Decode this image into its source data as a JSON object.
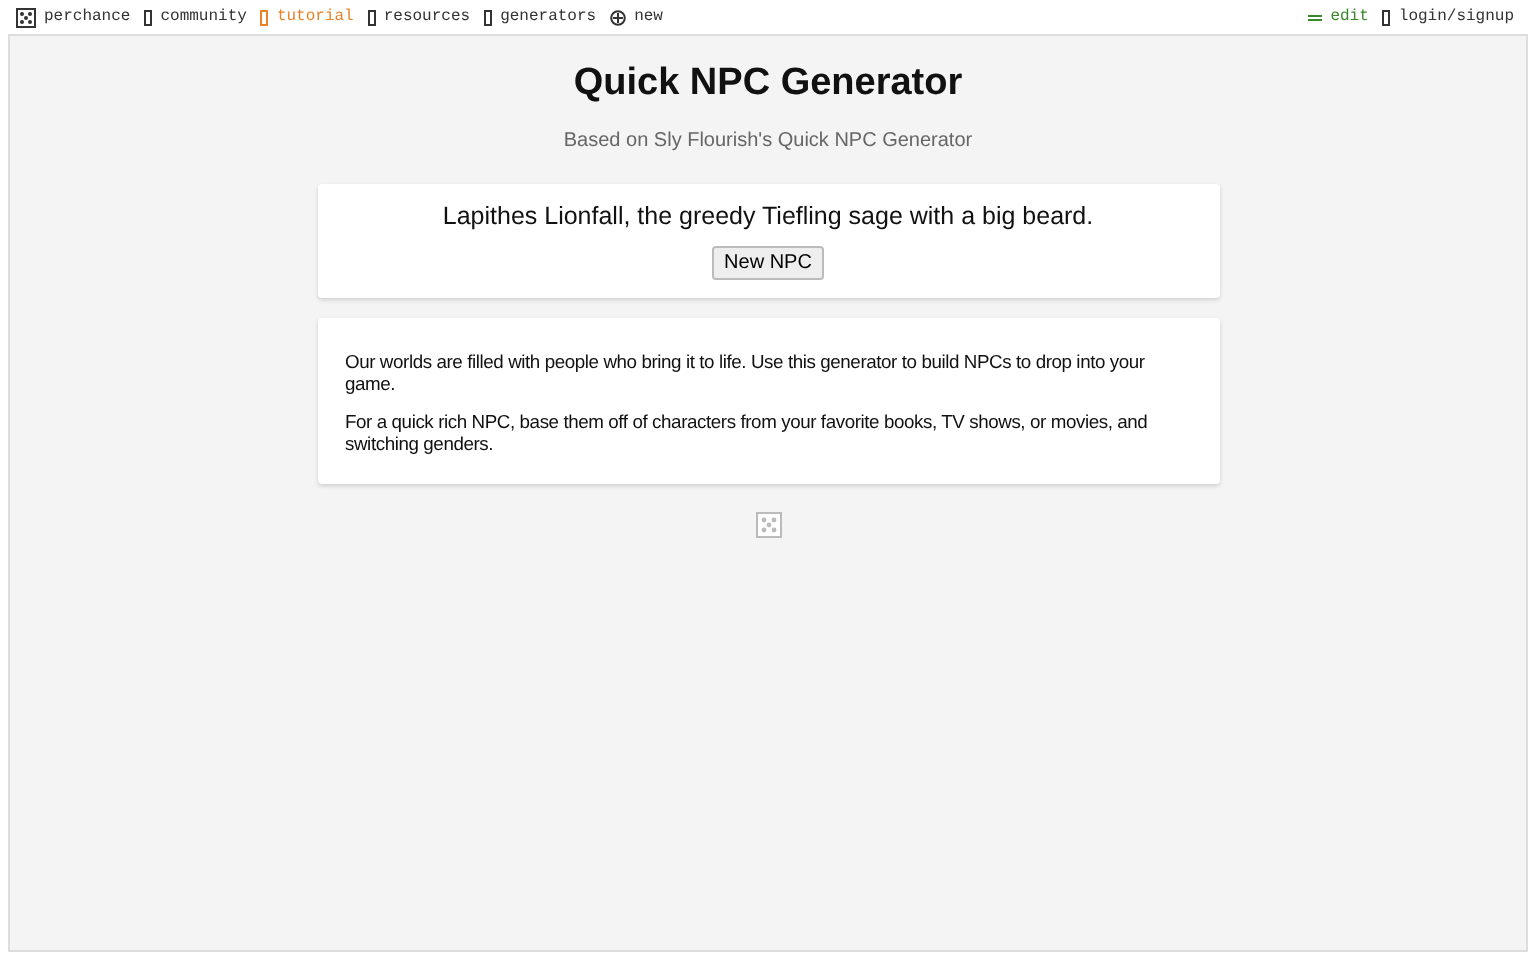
{
  "nav": {
    "brand": "perchance",
    "items": [
      {
        "label": "community",
        "color": "#333333"
      },
      {
        "label": "tutorial",
        "color": "#e8832a"
      },
      {
        "label": "resources",
        "color": "#333333"
      },
      {
        "label": "generators",
        "color": "#333333"
      }
    ],
    "new": "new",
    "edit": "edit",
    "login": "login/signup"
  },
  "title": "Quick NPC Generator",
  "subtitle": "Based on Sly Flourish's Quick NPC Generator",
  "result": "Lapithes Lionfall, the greedy Tiefling sage with a big beard.",
  "button": "New NPC",
  "paragraphs": [
    "Our worlds are filled with people who bring it to life. Use this generator to build NPCs to drop into your game.",
    "For a quick rich NPC, base them off of characters from your favorite books, TV shows, or movies, and switching genders."
  ]
}
